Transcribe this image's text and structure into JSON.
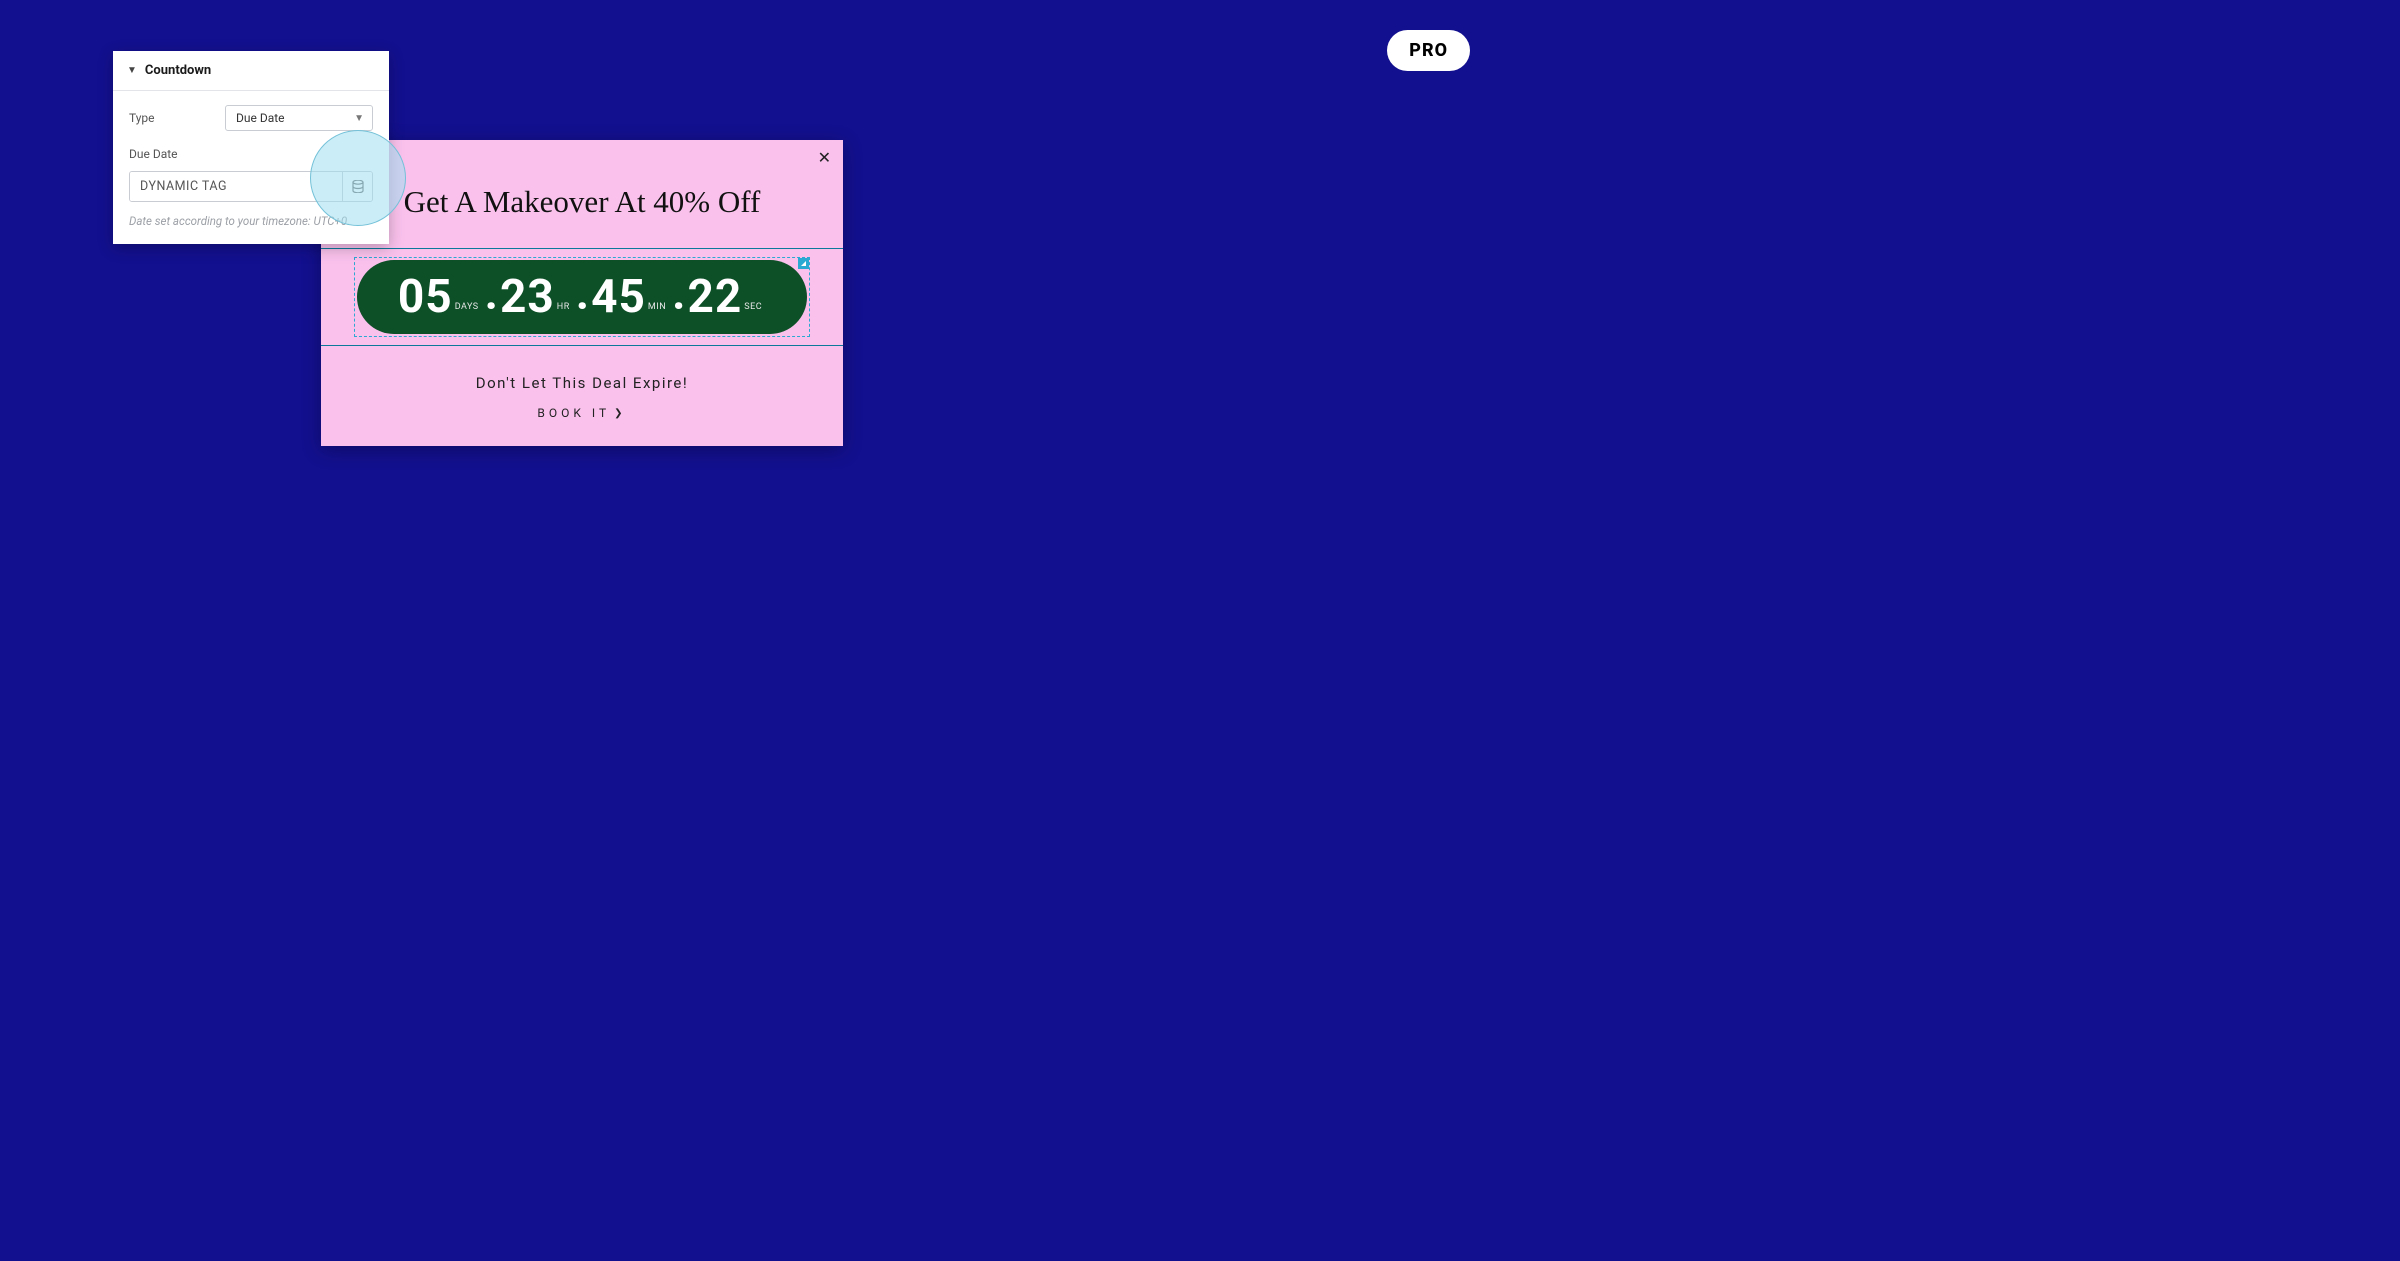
{
  "badge": {
    "label": "PRO"
  },
  "panel": {
    "title": "Countdown",
    "type_row": {
      "label": "Type",
      "selected": "Due Date"
    },
    "due_row": {
      "label": "Due Date",
      "value": "DYNAMIC TAG"
    },
    "timezone_note": "Date set according to your timezone: UTC+0."
  },
  "popup": {
    "title": "Get A Makeover At 40% Off",
    "countdown": {
      "days": "05",
      "days_label": "DAYS",
      "hours": "23",
      "hours_label": "HR",
      "minutes": "45",
      "minutes_label": "MIN",
      "seconds": "22",
      "seconds_label": "SEC"
    },
    "subtitle": "Don't Let This Deal Expire!",
    "cta": "BOOK IT"
  }
}
